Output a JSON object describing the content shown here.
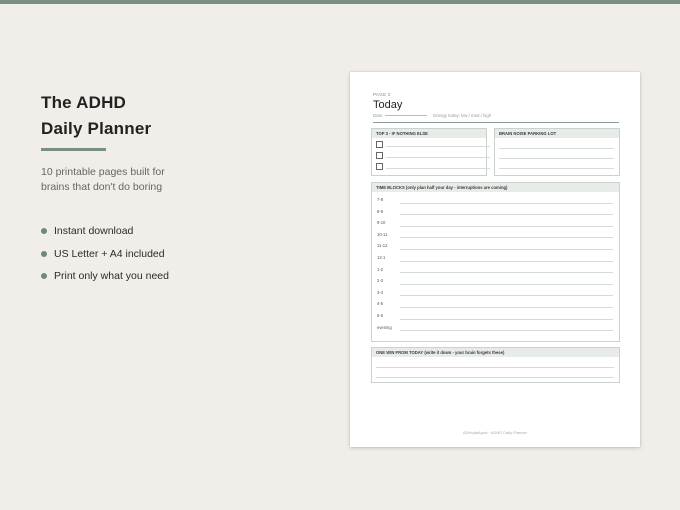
{
  "promo": {
    "title_line1": "The ADHD",
    "title_line2": "Daily Planner",
    "subtitle_line1": "10 printable pages built for",
    "subtitle_line2": "brains that don't do boring",
    "bullets": [
      "Instant download",
      "US Letter + A4 included",
      "Print only what you need"
    ]
  },
  "planner_page": {
    "page_label": "PAGE 2",
    "title": "Today",
    "date_label": "Date:",
    "energy_label": "Energy today:",
    "energy_options": "low  /  med  /  high",
    "top3": {
      "header": "TOP 3 - IF NOTHING ELSE"
    },
    "brain_noise": {
      "header": "BRAIN NOISE PARKING LOT"
    },
    "time_blocks": {
      "header": "TIME BLOCKS (only plan half your day - interruptions are coming)",
      "slots": [
        "7-8",
        "8-9",
        "9-10",
        "10-11",
        "11-12",
        "12-1",
        "1-2",
        "2-3",
        "3-4",
        "4-5",
        "5-6",
        "evening"
      ]
    },
    "one_win": {
      "header": "ONE WIN FROM TODAY (write it down - your brain forgets these)"
    },
    "footer": "ADHqdaApod  ·  ADHD Daily Planner"
  },
  "colors": {
    "accent": "#7a8f80",
    "background": "#f1eee9",
    "box_header": "#e7ece8"
  }
}
